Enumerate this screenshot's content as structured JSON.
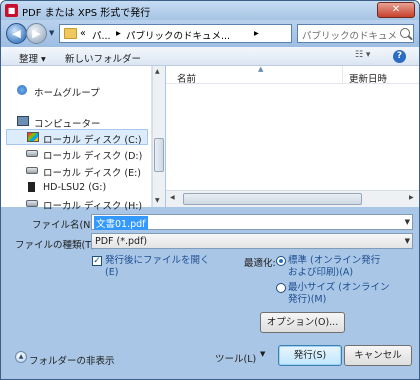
{
  "window": {
    "title": "PDF または XPS 形式で発行",
    "close_label": "✕"
  },
  "nav": {
    "address_segments": [
      "«",
      "パ...",
      "▸",
      "パブリックのドキュメ...",
      "▸"
    ],
    "search_placeholder": "パブリックのドキュメントの..."
  },
  "toolbar": {
    "organize_label": "整理 ▾",
    "new_folder_label": "新しいフォルダー",
    "views_label": "☷ ▾",
    "help_label": "?"
  },
  "tree": {
    "items": [
      {
        "label": "ホームグループ",
        "icon": "homegroup-icon"
      },
      {
        "label": "コンピューター",
        "icon": "computer-icon"
      },
      {
        "label": "ローカル ディスク (C:)",
        "icon": "windows-drive-icon",
        "selected": true
      },
      {
        "label": "ローカル ディスク (D:)",
        "icon": "drive-icon"
      },
      {
        "label": "ローカル ディスク (E:)",
        "icon": "drive-icon"
      },
      {
        "label": "HD-LSU2 (G:)",
        "icon": "external-drive-icon"
      },
      {
        "label": "ローカル ディスク (H:)",
        "icon": "drive-icon"
      }
    ]
  },
  "file_list": {
    "col_name": "名前",
    "col_date": "更新日時"
  },
  "form": {
    "filename_label": "ファイル名(N):",
    "filename_value": "文書01.pdf",
    "filetype_label": "ファイルの種類(T):",
    "filetype_value": "PDF (*.pdf)",
    "open_after_label_line1": "発行後にファイルを開く",
    "open_after_label_line2": "(E)",
    "open_after_checked": true,
    "optimize_label": "最適化:",
    "radio_standard_line1": "標準 (オンライン発行",
    "radio_standard_line2": "および印刷)(A)",
    "radio_minimum_line1": "最小サイズ (オンライン",
    "radio_minimum_line2": "発行)(M)",
    "options_button": "オプション(O)..."
  },
  "footer": {
    "hide_folders_label": "フォルダーの非表示",
    "tools_label": "ツール(L)",
    "publish_button": "発行(S)",
    "cancel_button": "キャンセル"
  },
  "colors": {
    "frame": "#a9c6e6",
    "selection": "#3399ff",
    "link_text": "#1d4f91"
  }
}
